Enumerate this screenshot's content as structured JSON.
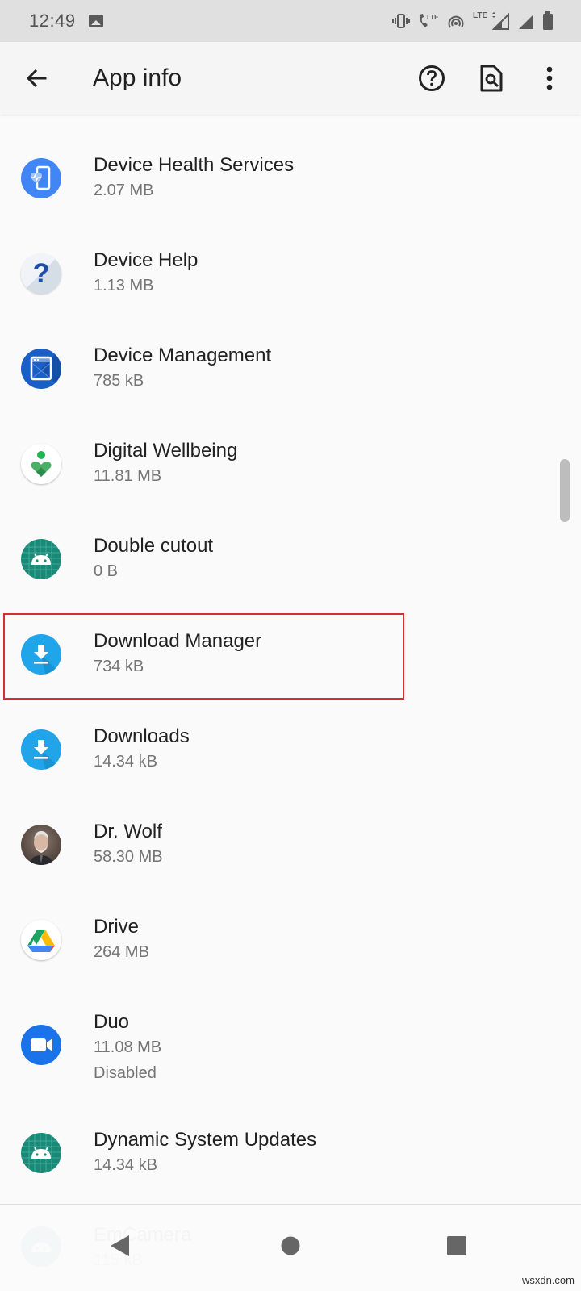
{
  "status_bar": {
    "time": "12:49",
    "notification_icons": [
      "gallery-icon"
    ],
    "system_icons": [
      "vibrate-icon",
      "volte-call-icon",
      "hotspot-icon",
      "lte-data-icon",
      "signal-icon",
      "signal-icon",
      "battery-icon"
    ],
    "lte_label": "LTE",
    "call_lte_label": "LTE"
  },
  "app_bar": {
    "title": "App info",
    "back_icon": "arrow-back-icon",
    "actions": [
      {
        "name": "help-button",
        "icon": "help-circle-icon"
      },
      {
        "name": "search-doc-button",
        "icon": "document-search-icon"
      },
      {
        "name": "more-options-button",
        "icon": "more-vert-icon"
      }
    ]
  },
  "apps": [
    {
      "name": "Device Health Services",
      "size": "2.07 MB",
      "icon": "device-health-icon"
    },
    {
      "name": "Device Help",
      "size": "1.13 MB",
      "icon": "question-icon"
    },
    {
      "name": "Device Management",
      "size": "785 kB",
      "icon": "device-management-icon"
    },
    {
      "name": "Digital Wellbeing",
      "size": "11.81 MB",
      "icon": "wellbeing-icon"
    },
    {
      "name": "Double cutout",
      "size": "0 B",
      "icon": "android-icon"
    },
    {
      "name": "Download Manager",
      "size": "734 kB",
      "icon": "download-icon",
      "highlighted": true
    },
    {
      "name": "Downloads",
      "size": "14.34 kB",
      "icon": "download-icon"
    },
    {
      "name": "Dr. Wolf",
      "size": "58.30 MB",
      "icon": "dr-wolf-avatar-icon"
    },
    {
      "name": "Drive",
      "size": "264 MB",
      "icon": "google-drive-icon"
    },
    {
      "name": "Duo",
      "size": "11.08 MB",
      "status": "Disabled",
      "icon": "duo-video-icon"
    },
    {
      "name": "Dynamic System Updates",
      "size": "14.34 kB",
      "icon": "android-icon"
    },
    {
      "name": "EmCamera",
      "size": "115 kB",
      "icon": "android-icon",
      "partially_hidden": true
    }
  ],
  "nav_bar": {
    "buttons": [
      {
        "name": "back-nav-button",
        "icon": "triangle-back-icon"
      },
      {
        "name": "home-nav-button",
        "icon": "circle-home-icon"
      },
      {
        "name": "recents-nav-button",
        "icon": "square-recents-icon"
      }
    ]
  },
  "colors": {
    "highlight": "#d32f2f",
    "status_bar_bg": "#e0e0e0",
    "app_bar_bg": "#f5f5f5",
    "list_bg": "#fafafa",
    "android_green": "#1a8a78",
    "download_blue": "#20a4ea",
    "duo_blue": "#1a73e8"
  },
  "scroll": {
    "position_fraction": 0.4
  },
  "watermark": "wsxdn.com"
}
